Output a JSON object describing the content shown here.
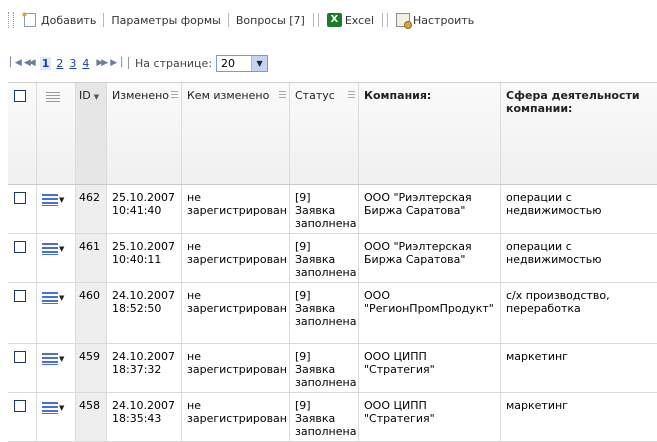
{
  "toolbar": {
    "add_label": "Добавить",
    "form_params_label": "Параметры формы",
    "questions_label": "Вопросы [7]",
    "excel_label": "Excel",
    "settings_label": "Настроить"
  },
  "pager": {
    "pages": [
      "1",
      "2",
      "3",
      "4"
    ],
    "current_page": "1",
    "per_page_label": "На странице:",
    "per_page_value": "20"
  },
  "grid": {
    "headers": {
      "id": "ID",
      "changed": "Изменено",
      "changed_by": "Кем изменено",
      "status": "Статус",
      "company": "Компания:",
      "activity": "Сфера деятельности компании:"
    },
    "rows": [
      {
        "id": "462",
        "changed": "25.10.2007 10:41:40",
        "changed_by": "не зарегистрирован",
        "status": "[9] Заявка заполнена",
        "company": "ООО \"Риэлтерская Биржа Саратова\"",
        "activity": "операции с недвижимостью"
      },
      {
        "id": "461",
        "changed": "25.10.2007 10:40:11",
        "changed_by": "не зарегистрирован",
        "status": "[9] Заявка заполнена",
        "company": "ООО \"Риэлтерская Биржа Саратова\"",
        "activity": "операции с недвижимостью"
      },
      {
        "id": "460",
        "changed": "24.10.2007 18:52:50",
        "changed_by": "не зарегистрирован",
        "status": "[9] Заявка заполнена",
        "company": "ООО \"РегионПромПродукт\"",
        "activity": "с/х производство, переработка"
      },
      {
        "id": "459",
        "changed": "24.10.2007 18:37:32",
        "changed_by": "не зарегистрирован",
        "status": "[9] Заявка заполнена",
        "company": "ООО ЦИПП \"Стратегия\"",
        "activity": "маркетинг"
      },
      {
        "id": "458",
        "changed": "24.10.2007 18:35:43",
        "changed_by": "не зарегистрирован",
        "status": "[9] Заявка заполнена",
        "company": "ООО ЦИПП \"Стратегия\"",
        "activity": "маркетинг"
      }
    ]
  }
}
